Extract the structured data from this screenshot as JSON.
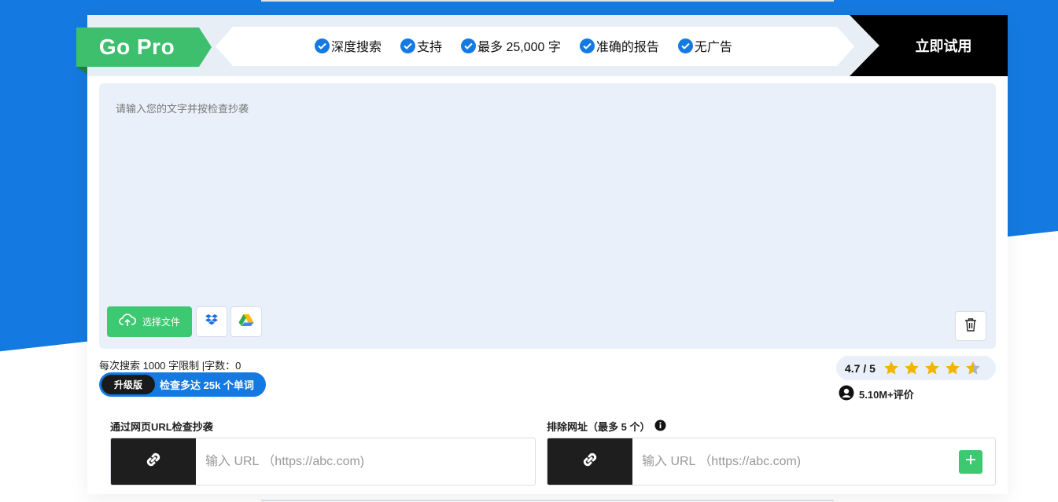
{
  "promo": {
    "badge": "Go Pro",
    "features": [
      "深度搜索",
      "支持",
      "最多 25,000 字",
      "准确的报告",
      "无广告"
    ],
    "cta": "立即试用"
  },
  "editor": {
    "placeholder": "请输入您的文字并按检查抄袭",
    "upload_label": "选择文件",
    "icons": [
      "upload-cloud-icon",
      "dropbox-icon",
      "google-drive-icon",
      "trash-icon"
    ]
  },
  "limits": {
    "text": "每次搜索 1000 字限制 |字数：0",
    "upgrade_tag": "升级版",
    "upgrade_text": "检查多达 25k 个单词"
  },
  "rating": {
    "score": "4.7 / 5",
    "stars": 4.7,
    "reviews": "5.10M+评价"
  },
  "url_check": {
    "label": "通过网页URL检查抄袭",
    "placeholder": "输入 URL （https://abc.com)"
  },
  "exclude": {
    "label": "排除网址（最多 5 个）",
    "placeholder": "输入 URL （https://abc.com)"
  },
  "colors": {
    "brand_blue": "#1479e0",
    "green": "#3dc872",
    "star": "#f5b301"
  }
}
